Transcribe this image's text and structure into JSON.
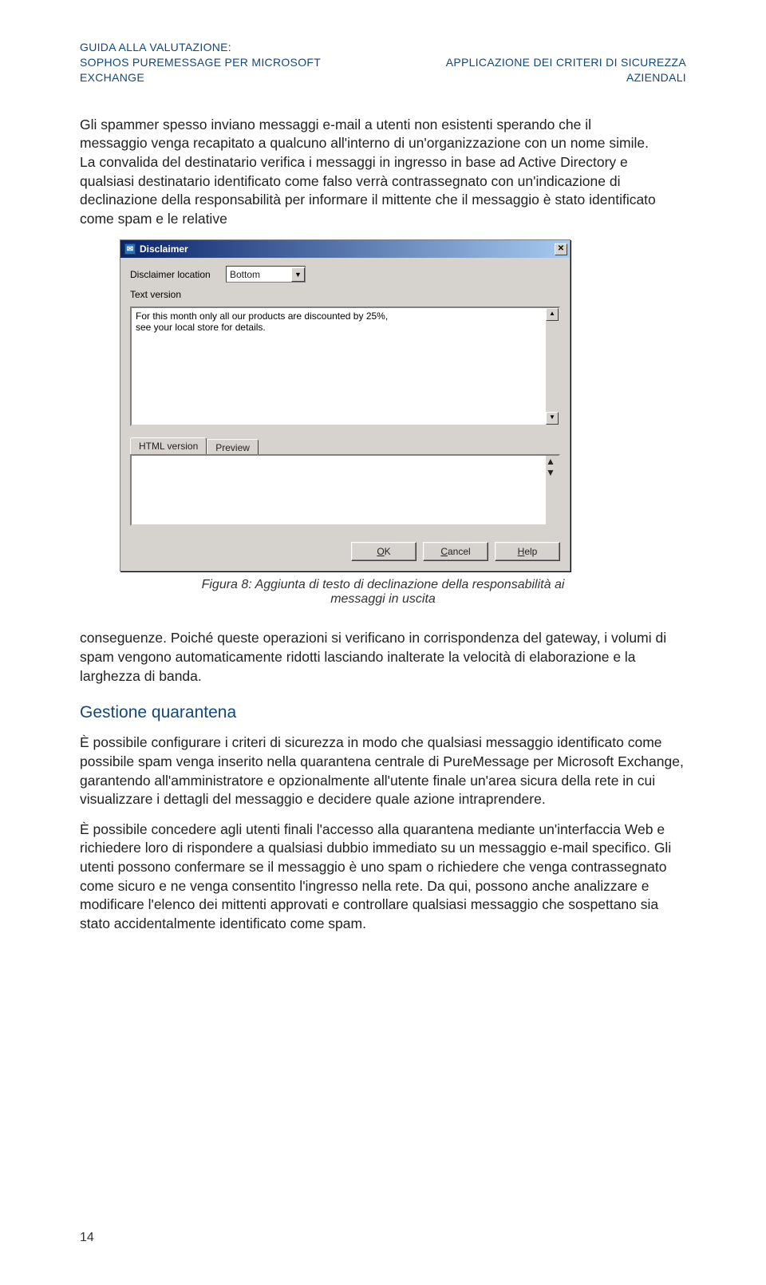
{
  "header": {
    "left_line1": "GUIDA ALLA VALUTAZIONE:",
    "left_line2": "SOPHOS PUREMESSAGE PER MICROSOFT EXCHANGE",
    "right": "APPLICAZIONE DEI CRITERI DI SICUREZZA AZIENDALI"
  },
  "para1": "Gli spammer spesso inviano messaggi e-mail a utenti non esistenti sperando che il messaggio venga recapitato a qualcuno all'interno di un'organizzazione con un nome simile. La convalida del destinatario verifica i messaggi in ingresso in base ad Active Directory e qualsiasi destinatario identificato come falso verrà contrassegnato con un'indicazione di declinazione della responsabilità per informare il mittente che il messaggio è stato identificato come spam e le relative",
  "dialog": {
    "title": "Disclaimer",
    "loc_label": "Disclaimer location",
    "loc_value": "Bottom",
    "text_label": "Text version",
    "text_content": "For this month only all our products are discounted by 25%,\nsee your local store for details.",
    "tab_html": "HTML version",
    "tab_preview": "Preview",
    "btn_ok": "OK",
    "btn_cancel": "Cancel",
    "btn_help": "Help"
  },
  "caption": "Figura 8: Aggiunta di testo di declinazione della responsabilità ai messaggi in uscita",
  "para2": "conseguenze. Poiché queste operazioni si verificano in corrispondenza del gateway, i volumi di spam vengono automaticamente ridotti lasciando inalterate la velocità di elaborazione e la larghezza di banda.",
  "heading1": "Gestione quarantena",
  "para3": "È possibile configurare i criteri di sicurezza in modo che qualsiasi messaggio identificato come possibile spam venga inserito nella quarantena centrale di PureMessage per Microsoft Exchange, garantendo all'amministratore e opzionalmente all'utente finale un'area sicura della rete in cui visualizzare i dettagli del messaggio e decidere quale azione intraprendere.",
  "para4": "È possibile concedere agli utenti finali l'accesso alla quarantena mediante un'interfaccia Web e richiedere loro di rispondere a qualsiasi dubbio immediato su un messaggio e-mail specifico. Gli utenti possono confermare se il messaggio è uno spam o richiedere che venga contrassegnato come sicuro e ne venga consentito l'ingresso nella rete. Da qui, possono anche analizzare e modificare l'elenco dei mittenti approvati e controllare qualsiasi messaggio che sospettano sia stato accidentalmente identificato come spam.",
  "page_number": "14"
}
